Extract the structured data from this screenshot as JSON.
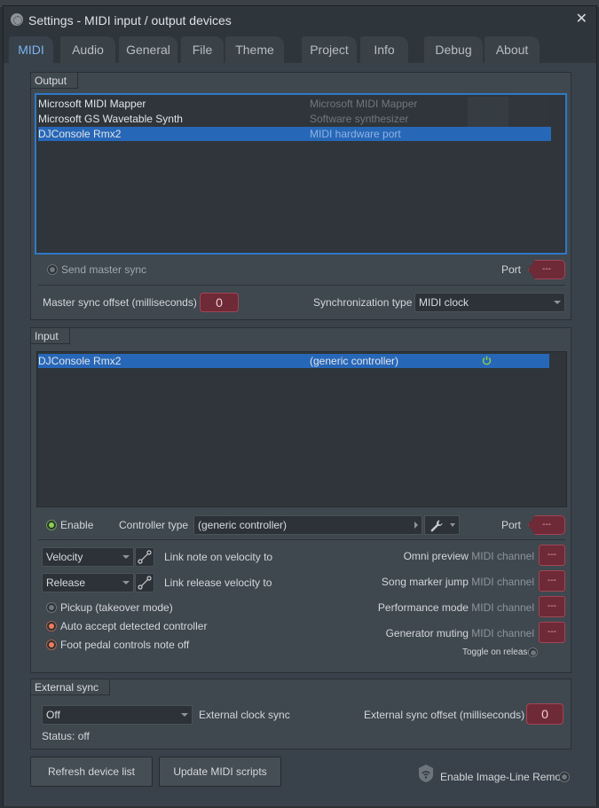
{
  "window": {
    "title": "Settings - MIDI input / output devices"
  },
  "tabs": [
    "MIDI",
    "Audio",
    "General",
    "File",
    "Theme",
    "Project",
    "Info",
    "Debug",
    "About"
  ],
  "active_tab": "MIDI",
  "output": {
    "group_label": "Output",
    "devices": [
      {
        "name": "Microsoft MIDI Mapper",
        "type": "Microsoft MIDI Mapper",
        "selected": false
      },
      {
        "name": "Microsoft GS Wavetable Synth",
        "type": "Software synthesizer",
        "selected": false
      },
      {
        "name": "DJConsole Rmx2",
        "type": "MIDI hardware port",
        "selected": true
      }
    ],
    "send_master_sync": "Send master sync",
    "port_label": "Port",
    "port_value": "---",
    "master_sync_offset_label": "Master sync offset (milliseconds)",
    "master_sync_offset_value": "0",
    "sync_type_label": "Synchronization type",
    "sync_type_value": "MIDI clock"
  },
  "input": {
    "group_label": "Input",
    "devices": [
      {
        "name": "DJConsole Rmx2",
        "type": "(generic controller)",
        "enabled": true,
        "selected": true
      }
    ],
    "enable_label": "Enable",
    "controller_type_label": "Controller type",
    "controller_type_value": "(generic controller)",
    "port_label": "Port",
    "port_value": "---",
    "link_note_combo": "Velocity",
    "link_note_label": "Link note on velocity to",
    "link_release_combo": "Release",
    "link_release_label": "Link release velocity to",
    "pickup_label": "Pickup (takeover mode)",
    "auto_accept_label": "Auto accept detected controller",
    "foot_pedal_label": "Foot pedal controls note off",
    "channels": [
      {
        "label": "Omni preview",
        "suffix": "MIDI channel",
        "value": "---"
      },
      {
        "label": "Song marker jump",
        "suffix": "MIDI channel",
        "value": "---"
      },
      {
        "label": "Performance mode",
        "suffix": "MIDI channel",
        "value": "---"
      },
      {
        "label": "Generator muting",
        "suffix": "MIDI channel",
        "value": "---"
      }
    ],
    "toggle_on_release": "Toggle on release"
  },
  "external_sync": {
    "group_label": "External sync",
    "clock_combo": "Off",
    "clock_label": "External clock sync",
    "offset_label": "External sync offset (milliseconds)",
    "offset_value": "0",
    "status": "Status: off"
  },
  "footer": {
    "refresh_button": "Refresh device list",
    "update_button": "Update MIDI scripts",
    "remote_label": "Enable Image-Line Remote"
  },
  "colors": {
    "accent_blue": "#2767b8",
    "tab_active_text": "#7bb6f0",
    "red_control": "#6e2a36",
    "enable_green": "#8ad04c",
    "option_on": "#f07b5e"
  }
}
